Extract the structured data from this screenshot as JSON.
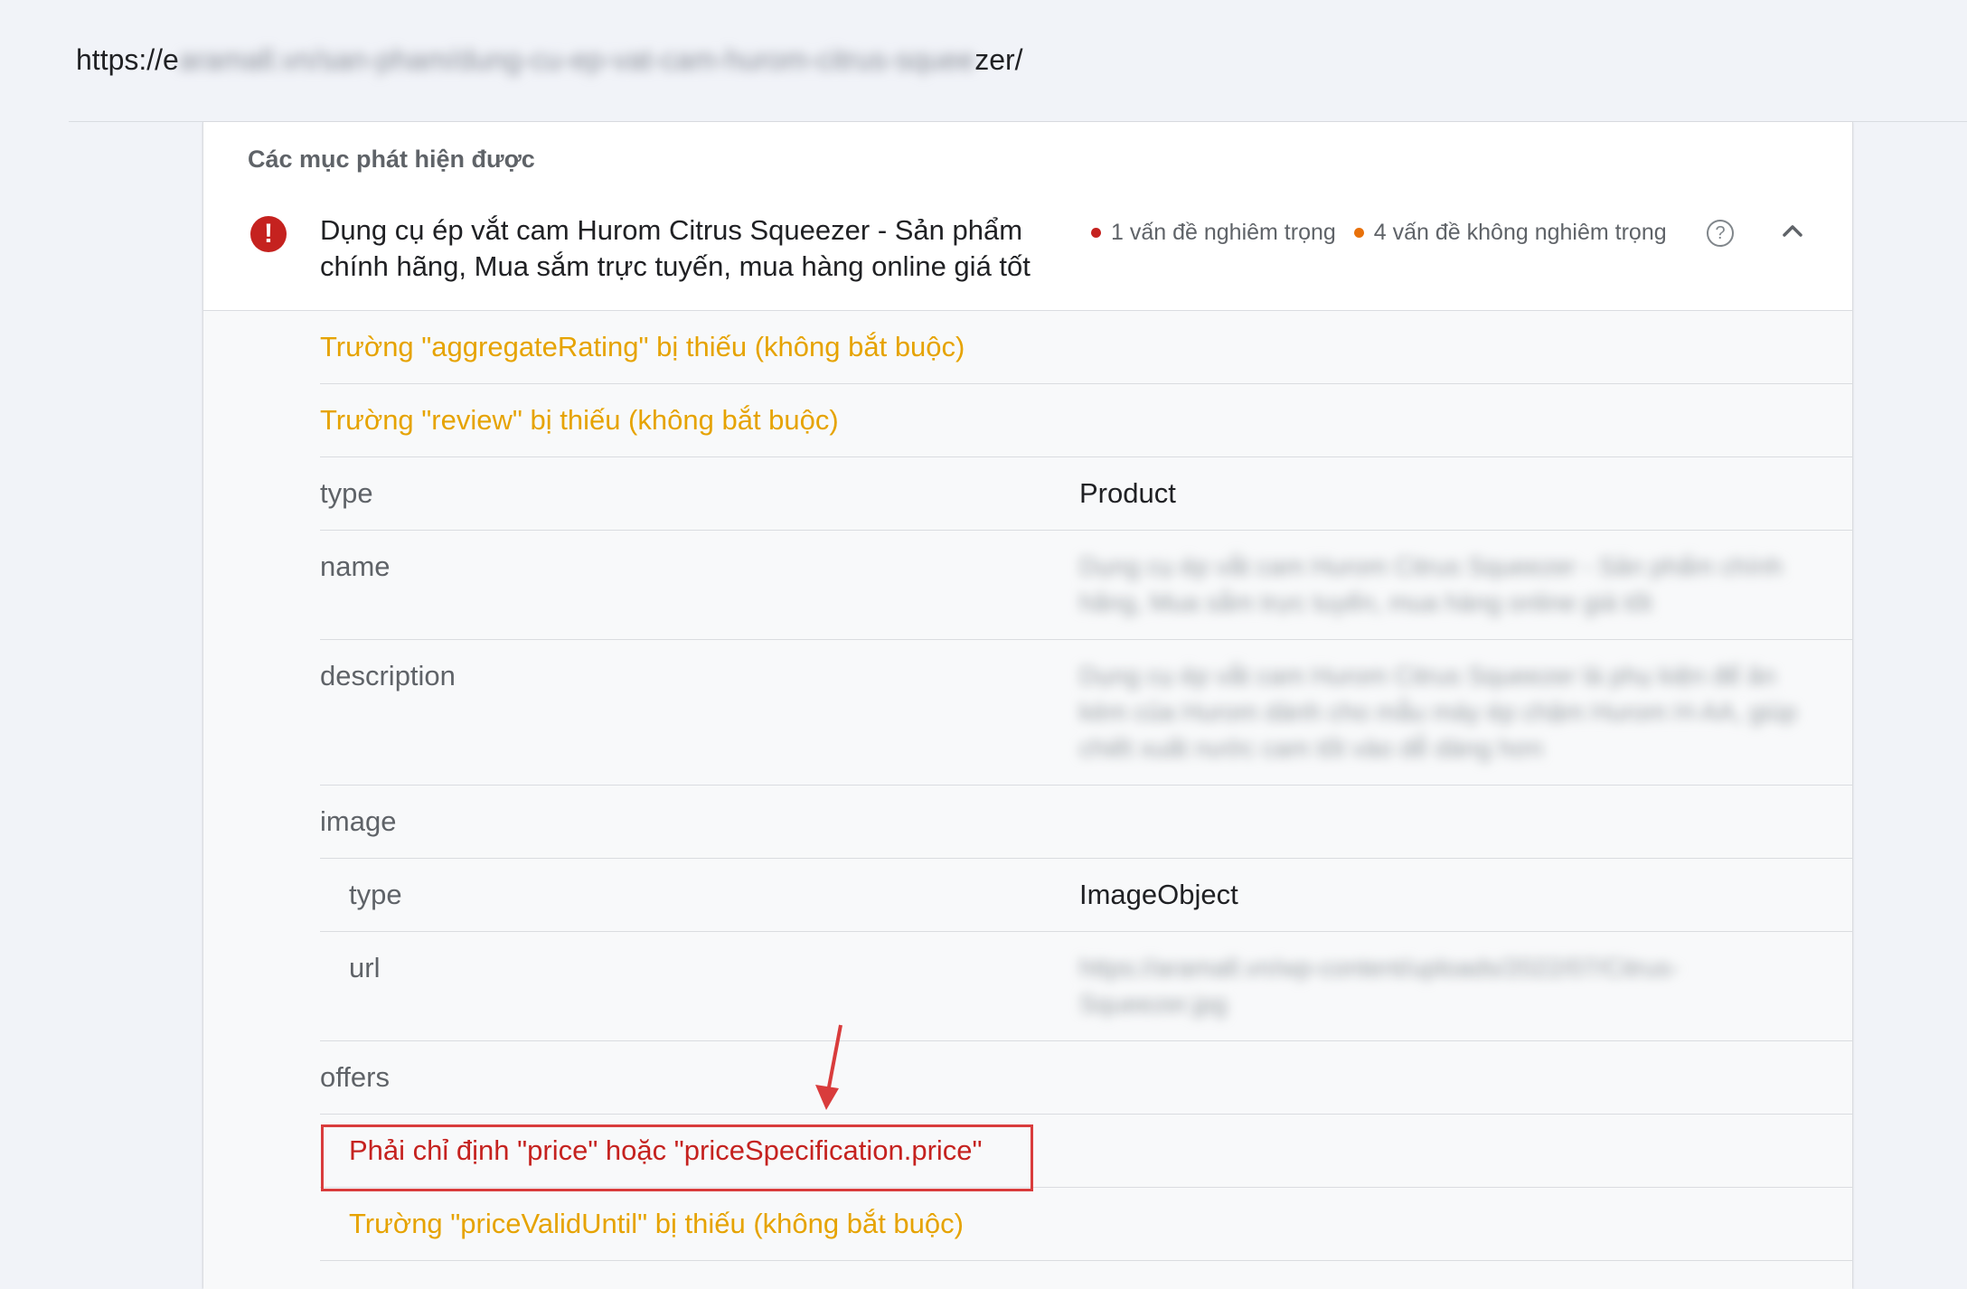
{
  "url": {
    "prefix": "https://e",
    "obscured": "aramall.vn/san-pham/dung-cu-ep-vat-cam-hurom-citrus-squee",
    "suffix": "zer/"
  },
  "section_title": "Các mục phát hiện được",
  "item": {
    "title": "Dụng cụ ép vắt cam Hurom Citrus Squeezer - Sản phẩm chính hãng, Mua sắm trực tuyến, mua hàng online giá tốt",
    "critical_issues": "1 vấn đề nghiêm trọng",
    "noncritical_issues": "4 vấn đề không nghiêm trọng"
  },
  "warnings": {
    "aggregate_rating": "Trường \"aggregateRating\" bị thiếu (không bắt buộc)",
    "review": "Trường \"review\" bị thiếu (không bắt buộc)",
    "price_valid_until": "Trường \"priceValidUntil\" bị thiếu (không bắt buộc)"
  },
  "errors": {
    "price": "Phải chỉ định \"price\" hoặc \"priceSpecification.price\""
  },
  "fields": {
    "type_key": "type",
    "type_val": "Product",
    "name_key": "name",
    "name_val": "Dụng cụ ép vắt cam Hurom Citrus Squeezer - Sản phẩm chính hãng, Mua sắm trực tuyến, mua hàng online giá tốt",
    "description_key": "description",
    "description_val": "Dụng cụ ép vắt cam Hurom Citrus Squeezer là phụ kiện để ăn kèm của Hurom dành cho mẫu máy ép chậm Hurom H-AA, giúp chiết xuất nước cam tốt vào dễ dàng hơn",
    "image_key": "image",
    "image_type_key": "type",
    "image_type_val": "ImageObject",
    "image_url_key": "url",
    "image_url_val": "https://aramall.vn/wp-content/uploads/2022/07/Citrus-Squeezer.jpg",
    "offers_key": "offers"
  },
  "colors": {
    "error": "#c5221f",
    "warning": "#e6a300",
    "highlight_box": "#d93c3c"
  }
}
